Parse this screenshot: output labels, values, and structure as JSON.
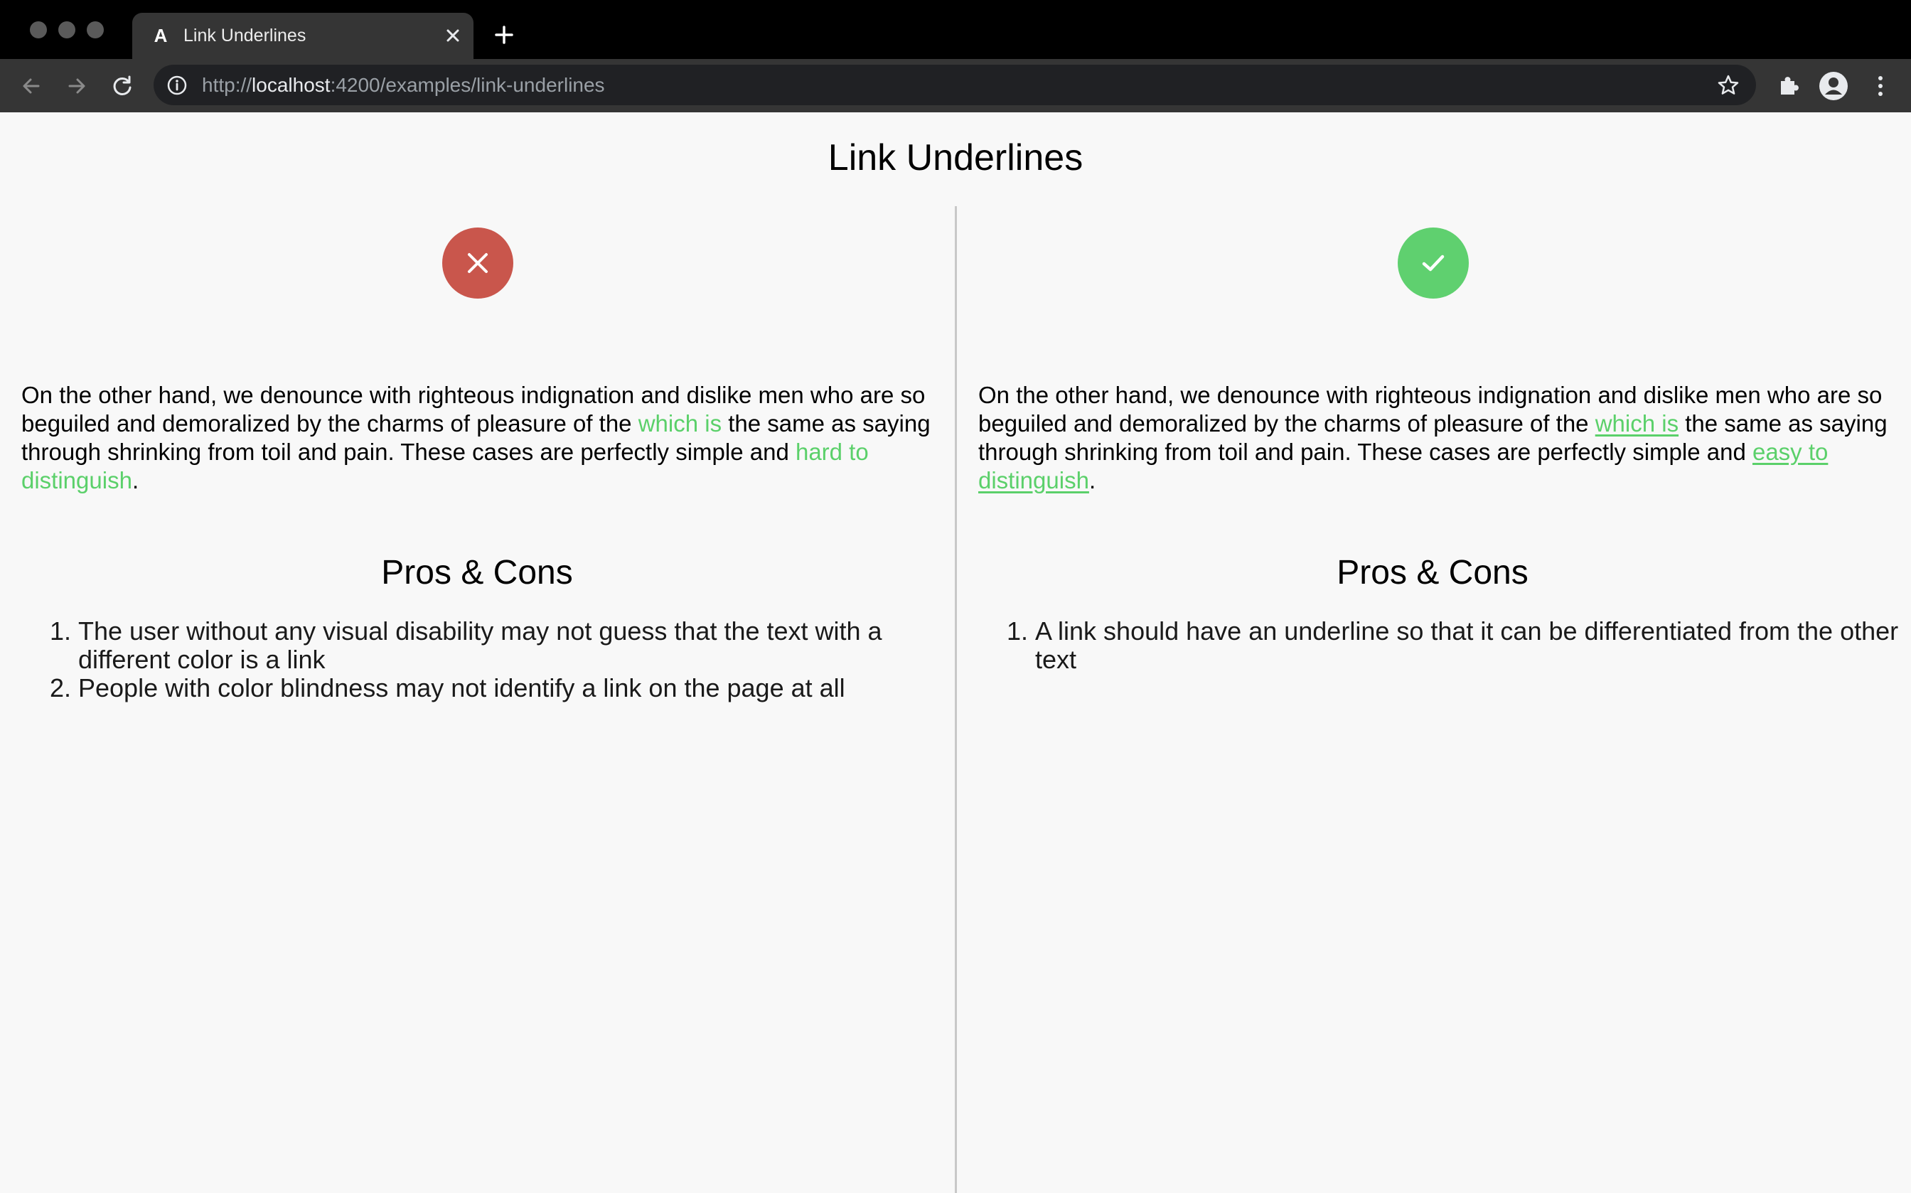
{
  "browser": {
    "tab_title": "Link Underlines",
    "tab_favicon": "A",
    "url_scheme": "http://",
    "url_host": "localhost",
    "url_rest": ":4200/examples/link-underlines"
  },
  "page": {
    "title": "Link Underlines",
    "bad": {
      "status": "x-mark-icon",
      "status_color": "#c9564c",
      "text_1": "On the other hand, we denounce with righteous indignation and dislike men who are so beguiled and demoralized by the charms of pleasure of the ",
      "link_1": "which is",
      "text_2": " the same as saying through shrinking from toil and pain. These cases are perfectly simple and ",
      "link_2": "hard to distinguish",
      "text_3": ".",
      "pros_title": "Pros & Cons",
      "items": [
        "The user without any visual disability may not guess that the text with a different color is a link",
        "People with color blindness may not identify a link on the page at all"
      ]
    },
    "good": {
      "status": "check-mark-icon",
      "status_color": "#5fd06f",
      "text_1": "On the other hand, we denounce with righteous indignation and dislike men who are so beguiled and demoralized by the charms of pleasure of the ",
      "link_1": "which is",
      "text_2": " the same as saying through shrinking from toil and pain. These cases are perfectly simple and ",
      "link_2": "easy to distinguish",
      "text_3": ".",
      "pros_title": "Pros & Cons",
      "items": [
        "A link should have an underline so that it can be differentiated from the other text"
      ]
    },
    "link_color": "#5bd06a"
  }
}
